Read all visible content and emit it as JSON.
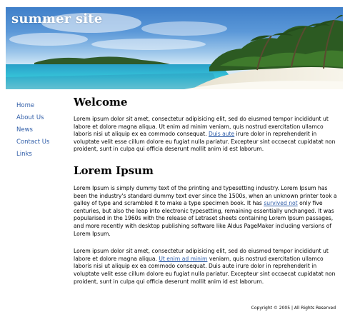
{
  "site": {
    "title": "summer site"
  },
  "nav": {
    "items": [
      {
        "label": "Home"
      },
      {
        "label": "About Us"
      },
      {
        "label": "News"
      },
      {
        "label": "Contact Us"
      },
      {
        "label": "Links"
      }
    ]
  },
  "main": {
    "welcome": {
      "heading": "Welcome",
      "text_before_link": "Lorem ipsum dolor sit amet, consectetur adipisicing elit, sed do eiusmod tempor incididunt ut labore et dolore magna aliqua. Ut enim ad minim veniam, quis nostrud exercitation ullamco laboris nisi ut aliquip ex ea commodo consequat. ",
      "link": "Duis aute",
      "text_after_link": " irure dolor in reprehenderit in voluptate velit esse cillum dolore eu fugiat nulla pariatur. Excepteur sint occaecat cupidatat non proident, sunt in culpa qui officia deserunt mollit anim id est laborum."
    },
    "lorem": {
      "heading": "Lorem Ipsum",
      "p1_before_link": "Lorem Ipsum is simply dummy text of the printing and typesetting industry. Lorem Ipsum has been the industry's standard dummy text ever since the 1500s, when an unknown printer took a galley of type and scrambled it to make a type specimen book. It has ",
      "p1_link": "survived not",
      "p1_after_link": " only five centuries, but also the leap into electronic typesetting, remaining essentially unchanged. It was popularised in the 1960s with the release of Letraset sheets containing Lorem Ipsum passages, and more recently with desktop publishing software like Aldus PageMaker including versions of Lorem Ipsum.",
      "p2_before_link": "Lorem ipsum dolor sit amet, consectetur adipisicing elit, sed do eiusmod tempor incididunt ut labore et dolore magna aliqua. ",
      "p2_link": "Ut enim ad minim",
      "p2_after_link": " veniam, quis nostrud exercitation ullamco laboris nisi ut aliquip ex ea commodo consequat. Duis aute irure dolor in reprehenderit in voluptate velit esse cillum dolore eu fugiat nulla pariatur. Excepteur sint occaecat cupidatat non proident, sunt in culpa qui officia deserunt mollit anim id est laborum."
    }
  },
  "footer": {
    "text": "Copyright © 2005 | All Rights Reserved"
  }
}
